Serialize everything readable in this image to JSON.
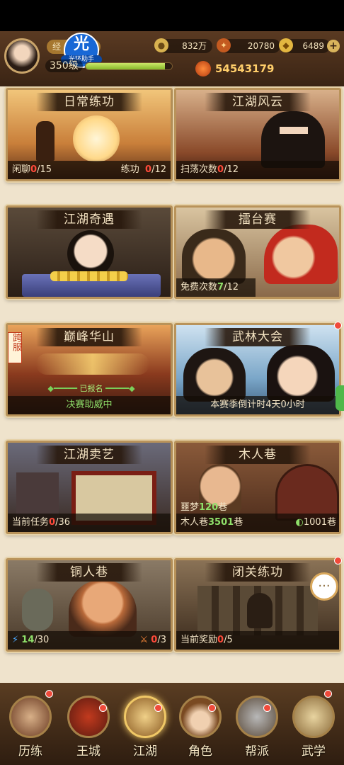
{
  "header": {
    "exp_label": "经",
    "helper_logo_char": "光",
    "helper_logo_text": "光环助手",
    "level": "350级",
    "exp_fraction": 0.92,
    "coins": "832万",
    "currency2": "20780",
    "gold": "6489",
    "power": "54543179"
  },
  "cards": {
    "daily": {
      "title": "日常练功",
      "left_label": "闲聊",
      "left_cur": "0",
      "left_total": "/15",
      "right_label": "练功",
      "right_cur": "0",
      "right_total": "/12"
    },
    "jianghu_fengyun": {
      "title": "江湖风云",
      "label": "扫荡次数",
      "cur": "0",
      "total": "/12"
    },
    "jianghu_qiyu": {
      "title": "江湖奇遇"
    },
    "leitai": {
      "title": "擂台赛",
      "label": "免费次数",
      "cur": "7",
      "total": "/12"
    },
    "huashan": {
      "title": "巅峰华山",
      "cross_tag": "跨服",
      "status": "已报名",
      "footer": "决赛助威中"
    },
    "wulin": {
      "title": "武林大会",
      "footer": "本赛季倒计时4天0小时"
    },
    "maiyi": {
      "title": "江湖卖艺",
      "label": "当前任务",
      "cur": "0",
      "total": "/36"
    },
    "murenxiang": {
      "title": "木人巷",
      "line1_label": "噩梦",
      "line1_value": "120",
      "line1_unit": "巷",
      "line2_label": "木人巷",
      "line2_value": "3501",
      "line2_unit": "巷",
      "badge_value": "1001",
      "badge_unit": "巷"
    },
    "tongrenxiang": {
      "title": "铜人巷",
      "energy_cur": "14",
      "energy_total": "/30",
      "right_cur": "0",
      "right_total": "/3"
    },
    "biguan": {
      "title": "闭关练功",
      "label": "当前奖励",
      "cur": "0",
      "total": "/5"
    }
  },
  "nav": {
    "items": [
      "历练",
      "王城",
      "江湖",
      "角色",
      "帮派",
      "武学"
    ],
    "active": "江湖"
  }
}
